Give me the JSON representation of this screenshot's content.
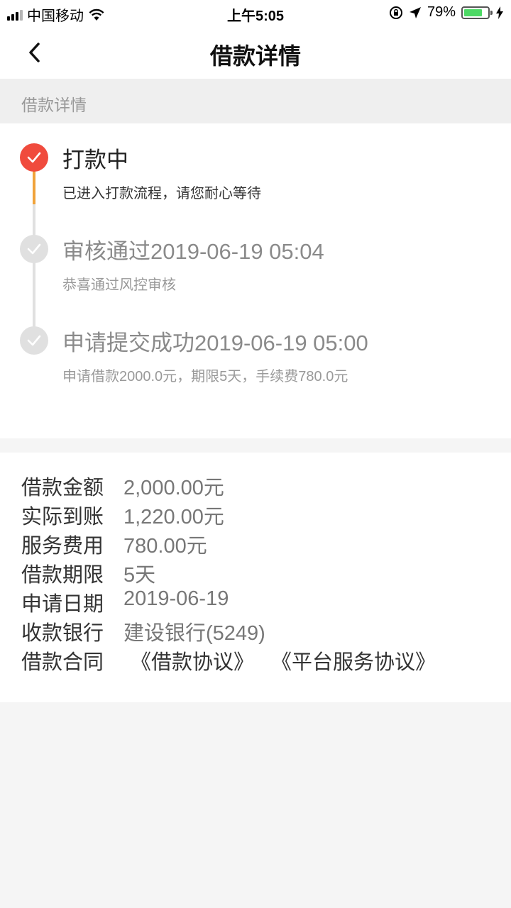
{
  "status_bar": {
    "carrier": "中国移动",
    "time": "上午5:05",
    "battery": "79%",
    "battery_level": 0.79
  },
  "nav": {
    "title": "借款详情"
  },
  "section": {
    "label": "借款详情"
  },
  "colors": {
    "accent_red": "#f04b3d",
    "progress_orange": "#f0a33a",
    "inactive_gray": "#e0e0e0"
  },
  "timeline": [
    {
      "title": "打款中",
      "desc": "已进入打款流程，请您耐心等待",
      "state": "active"
    },
    {
      "title": "审核通过2019-06-19 05:04",
      "desc": "恭喜通过风控审核",
      "state": "done"
    },
    {
      "title": "申请提交成功2019-06-19 05:00",
      "desc": "申请借款2000.0元，期限5天，手续费780.0元",
      "state": "done"
    }
  ],
  "details": {
    "amount": {
      "label": "借款金额",
      "value": "2,000.00元"
    },
    "received": {
      "label": "实际到账",
      "value": "1,220.00元"
    },
    "fee": {
      "label": "服务费用",
      "value": "780.00元"
    },
    "term": {
      "label": "借款期限",
      "value": "5天"
    },
    "date": {
      "label": "申请日期",
      "value": "2019-06-19"
    },
    "bank": {
      "label": "收款银行",
      "value": "建设银行(5249)"
    },
    "contract": {
      "label": "借款合同",
      "links": [
        "《借款协议》",
        "《平台服务协议》"
      ]
    }
  }
}
